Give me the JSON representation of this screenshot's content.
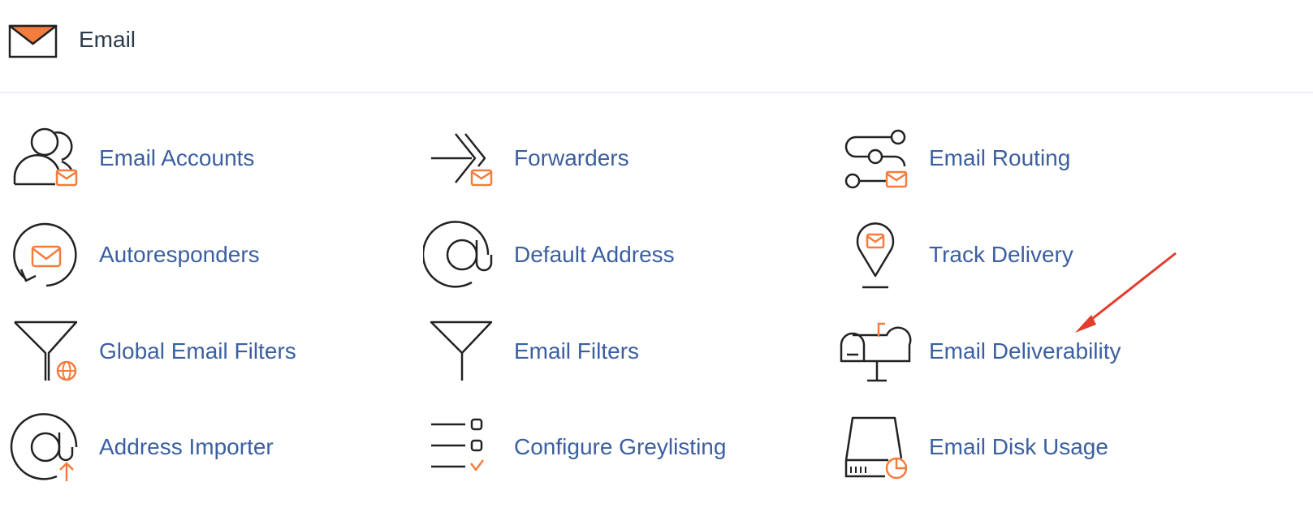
{
  "section": {
    "title": "Email",
    "icon": "envelope-icon"
  },
  "items": [
    {
      "label": "Email Accounts",
      "icon": "user-mail-icon"
    },
    {
      "label": "Forwarders",
      "icon": "forward-arrows-icon"
    },
    {
      "label": "Email Routing",
      "icon": "routing-icon"
    },
    {
      "label": "Autoresponders",
      "icon": "autoresponder-icon"
    },
    {
      "label": "Default Address",
      "icon": "at-sign-icon"
    },
    {
      "label": "Track Delivery",
      "icon": "location-pin-icon"
    },
    {
      "label": "Global Email Filters",
      "icon": "funnel-globe-icon"
    },
    {
      "label": "Email Filters",
      "icon": "funnel-icon"
    },
    {
      "label": "Email Deliverability",
      "icon": "mailbox-icon"
    },
    {
      "label": "Address Importer",
      "icon": "at-import-icon"
    },
    {
      "label": "Configure Greylisting",
      "icon": "checklist-icon"
    },
    {
      "label": "Email Disk Usage",
      "icon": "disk-pie-icon"
    }
  ],
  "colors": {
    "accent": "#f47c3c",
    "link": "#3b5fa0",
    "icon_stroke": "#222222",
    "annotation_arrow": "#e23d2e"
  }
}
